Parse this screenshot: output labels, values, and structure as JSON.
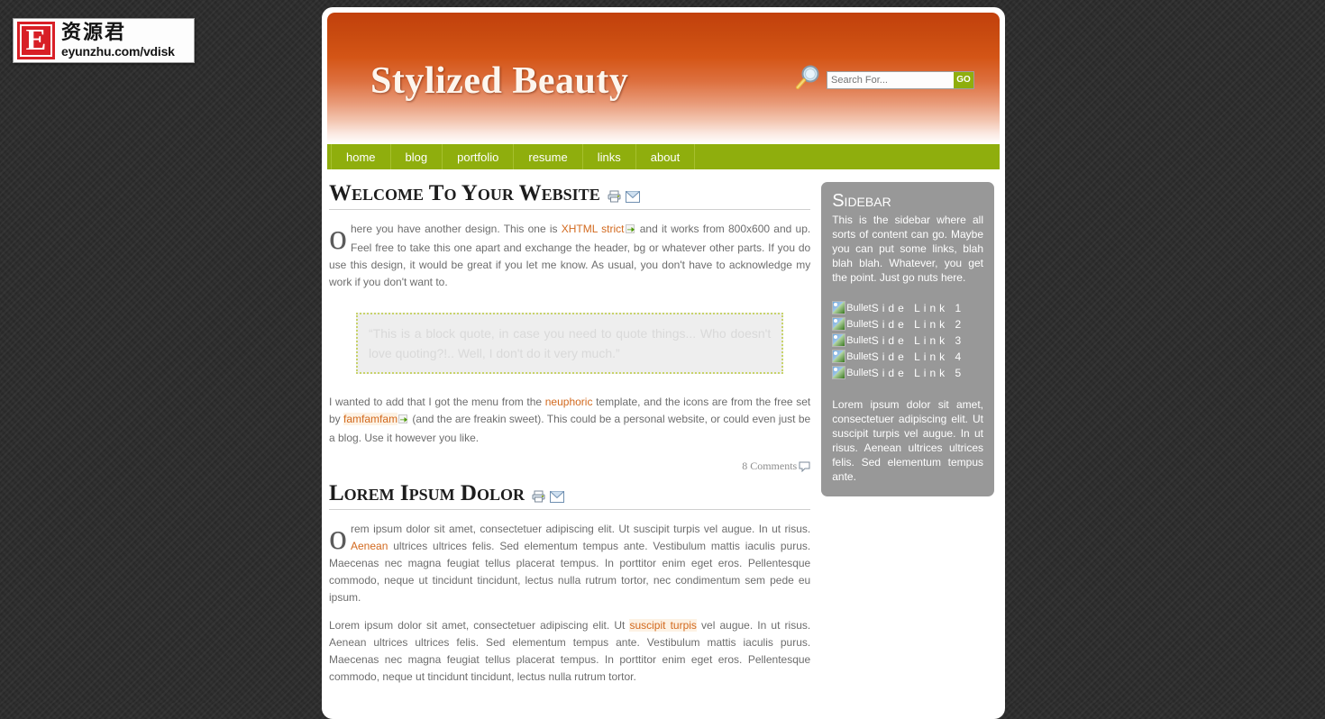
{
  "watermark": {
    "logo_letter": "E",
    "cn_text": "资源君",
    "url": "eyunzhu.com/vdisk"
  },
  "header": {
    "site_title": "Stylized Beauty",
    "magnifier_icon": "search-icon",
    "search": {
      "placeholder": "Search For...",
      "value": "",
      "go_label": "GO"
    }
  },
  "nav": {
    "items": [
      {
        "label": "home"
      },
      {
        "label": "blog"
      },
      {
        "label": "portfolio"
      },
      {
        "label": "resume"
      },
      {
        "label": "links"
      },
      {
        "label": "about"
      }
    ]
  },
  "articles": [
    {
      "title": "Welcome To Your Website",
      "icons": [
        "print-icon",
        "email-icon"
      ],
      "body_1a": "o here you have another design. This one is ",
      "link_1": "XHTML strict",
      "body_1b": " and it works from 800x600 and up. Feel free to take this one apart and exchange the header, bg or whatever other parts. If you do use this design, it would be great if you let me know. As usual, you don't have to acknowledge my work if you don't want to.",
      "blockquote": "“This is a block quote, in case you need to quote things... Who doesn't love quoting?!.. Well, I don't do it very much.”",
      "body_2a": "I wanted to add that I got the menu from the ",
      "link_2": "neuphoric",
      "body_2b": " template, and the icons are from the free set by ",
      "link_3": "famfamfam",
      "body_2c": " (and the are freakin sweet). This could be a personal website, or could even just be a blog. Use it however you like.",
      "comments": "8 Comments",
      "comments_icon": "comment-bubble-icon"
    },
    {
      "title": "Lorem Ipsum Dolor",
      "icons": [
        "print-icon",
        "email-icon"
      ],
      "body_1a": "orem ipsum dolor sit amet, consectetuer adipiscing elit. Ut suscipit turpis vel augue. In ut risus. ",
      "link_1": "Aenean",
      "body_1b": " ultrices ultrices felis. Sed elementum tempus ante. Vestibulum mattis iaculis purus. Maecenas nec magna feugiat tellus placerat tempus. In porttitor enim eget eros. Pellentesque commodo, neque ut tincidunt tincidunt, lectus nulla rutrum tortor, nec condimentum sem pede eu ipsum.",
      "body_2a": "Lorem ipsum dolor sit amet, consectetuer adipiscing elit. Ut ",
      "link_2": "suscipit turpis",
      "body_2b": " vel augue. In ut risus. Aenean ultrices ultrices felis. Sed elementum tempus ante. Vestibulum mattis iaculis purus. Maecenas nec magna feugiat tellus placerat tempus. In porttitor enim eget eros. Pellentesque commodo, neque ut tincidunt tincidunt, lectus nulla rutrum tortor."
    }
  ],
  "sidebar": {
    "title": "Sidebar",
    "intro": "This is the sidebar where all sorts of content can go. Maybe you can put some links, blah blah blah. Whatever, you get the point. Just go nuts here.",
    "links": [
      {
        "bullet_alt": "Bullet",
        "label": "Side Link 1"
      },
      {
        "bullet_alt": "Bullet",
        "label": "Side Link 2"
      },
      {
        "bullet_alt": "Bullet",
        "label": "Side Link 3"
      },
      {
        "bullet_alt": "Bullet",
        "label": "Side Link 4"
      },
      {
        "bullet_alt": "Bullet",
        "label": "Side Link 5"
      }
    ],
    "outro": "Lorem ipsum dolor sit amet, consectetuer adipiscing elit. Ut suscipit turpis vel augue. In ut risus. Aenean ultrices ultrices felis. Sed elementum tempus ante."
  },
  "colors": {
    "header_top": "#c2400c",
    "nav_green": "#8fae0d",
    "link_orange": "#d2691e",
    "sidebar_gray": "#989898",
    "page_bg": "#2b2b2b"
  }
}
